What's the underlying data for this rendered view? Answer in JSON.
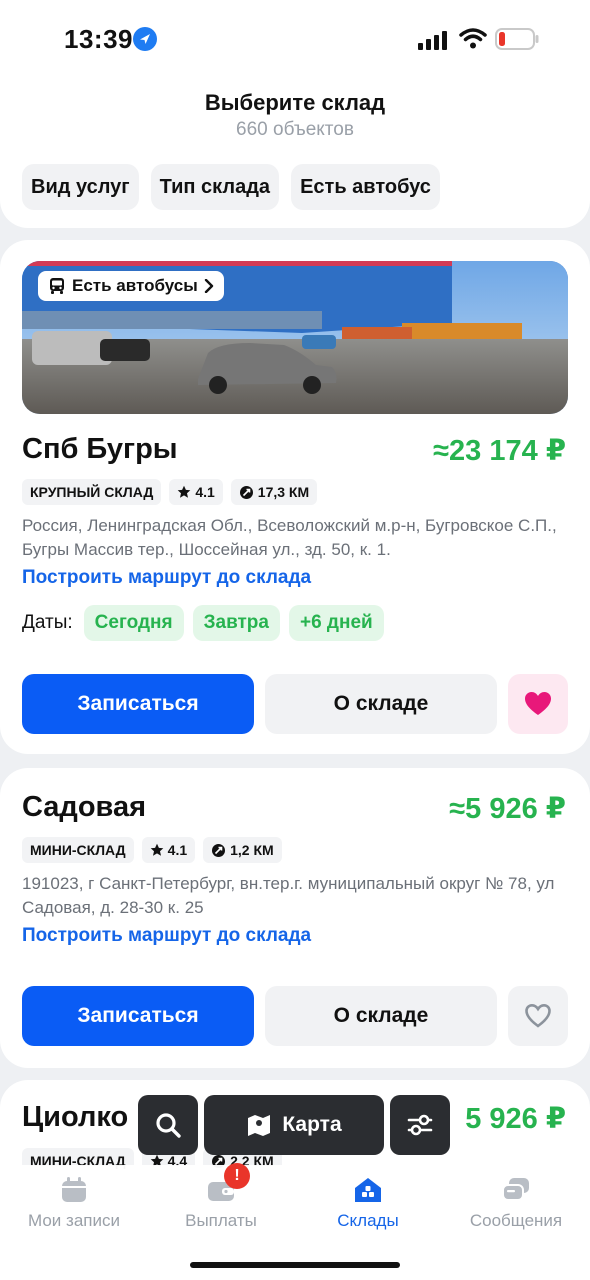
{
  "status": {
    "time": "13:39"
  },
  "header": {
    "title": "Выберите склад",
    "subtitle": "660 объектов",
    "filters": [
      "Вид услуг",
      "Тип склада",
      "Есть автобус"
    ]
  },
  "warehouses": [
    {
      "badge": "Есть автобусы",
      "name": "Спб Бугры",
      "price": "≈23 174 ₽",
      "type": "КРУПНЫЙ СКЛАД",
      "rating": "4.1",
      "distance": "17,3 КМ",
      "address": "Россия, Ленинградская Обл., Всеволожский м.р-н, Бугровское С.П., Бугры Массив тер., Шоссейная ул., зд. 50, к. 1.",
      "route": "Построить маршрут до склада",
      "dates_label": "Даты:",
      "dates": [
        "Сегодня",
        "Завтра",
        "+6 дней"
      ],
      "signup": "Записаться",
      "about": "О складе",
      "favorite": true
    },
    {
      "name": "Садовая",
      "price": "≈5 926 ₽",
      "type": "МИНИ-СКЛАД",
      "rating": "4.1",
      "distance": "1,2 КМ",
      "address": "191023, г Санкт-Петербург, вн.тер.г. муниципальный округ № 78, ул Садовая, д. 28-30 к. 25",
      "route": "Построить маршрут до склада",
      "signup": "Записаться",
      "about": "О складе",
      "favorite": false
    },
    {
      "name": "Циолко",
      "price": "5 926 ₽",
      "type": "МИНИ-СКЛАД",
      "rating": "4.4",
      "distance": "2,2 КМ"
    }
  ],
  "floating": {
    "map_label": "Карта"
  },
  "tabs": [
    {
      "label": "Мои записи",
      "icon": "calendar-icon"
    },
    {
      "label": "Выплаты",
      "icon": "wallet-icon",
      "badge": "!"
    },
    {
      "label": "Склады",
      "icon": "warehouse-icon",
      "active": true
    },
    {
      "label": "Сообщения",
      "icon": "chat-icon"
    }
  ],
  "colors": {
    "accent": "#0a5cf5",
    "price": "#27b34f",
    "favorite": "#e8187a",
    "badge": "#e9352a"
  }
}
